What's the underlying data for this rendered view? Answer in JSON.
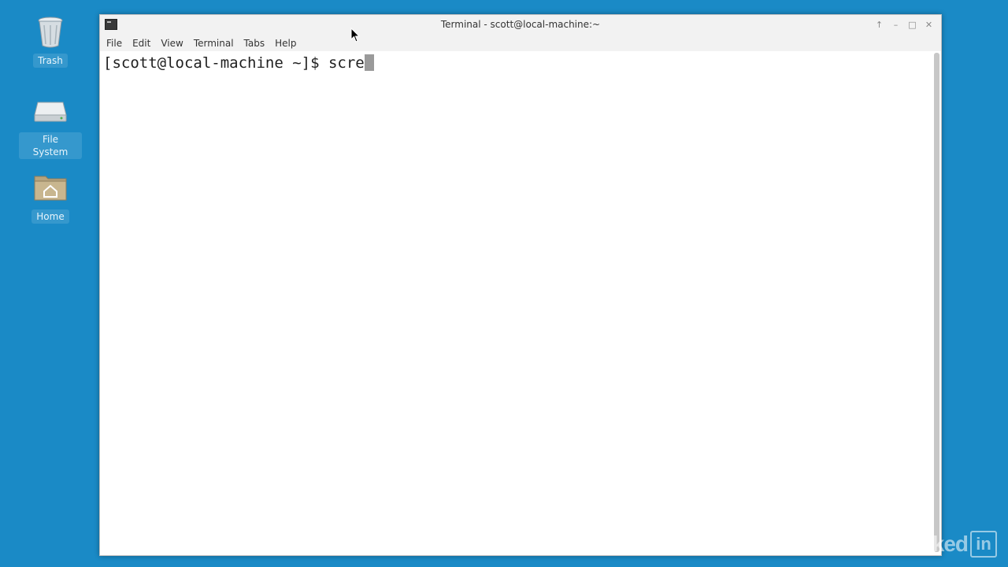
{
  "desktop": {
    "icons": [
      {
        "label": "Trash",
        "icon": "trash-icon"
      },
      {
        "label": "File System",
        "icon": "drive-icon"
      },
      {
        "label": "Home",
        "icon": "home-folder-icon"
      }
    ]
  },
  "window": {
    "title": "Terminal - scott@local-machine:~",
    "controls": [
      "↑",
      "–",
      "□",
      "✕"
    ],
    "menu": [
      "File",
      "Edit",
      "View",
      "Terminal",
      "Tabs",
      "Help"
    ]
  },
  "terminal": {
    "prompt": "[scott@local-machine ~]$ ",
    "input": "scre"
  },
  "watermark": {
    "text": "Linked",
    "box": "in"
  },
  "colors": {
    "desktop_bg": "#1a8ac6",
    "terminal_bg": "#ffffff",
    "cursor": "#9a9a9a"
  }
}
